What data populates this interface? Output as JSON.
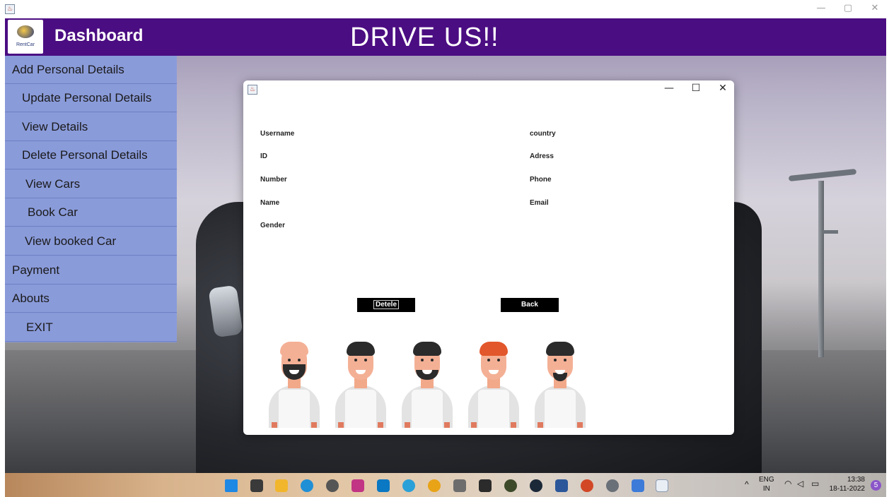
{
  "outer_window": {
    "controls": [
      "—",
      "▢",
      "✕"
    ]
  },
  "header": {
    "logo_text": "RentCar",
    "title": "Dashboard",
    "banner": "DRIVE US!!"
  },
  "sidebar": {
    "items": [
      {
        "label": "Add Personal Details"
      },
      {
        "label": "Update Personal Details"
      },
      {
        "label": "View Details"
      },
      {
        "label": "Delete Personal Details"
      },
      {
        "label": "View Cars"
      },
      {
        "label": "Book Car"
      },
      {
        "label": "View booked Car"
      },
      {
        "label": "Payment"
      },
      {
        "label": "Abouts"
      },
      {
        "label": "EXIT"
      }
    ]
  },
  "dialog": {
    "controls": {
      "minimize": "—",
      "maximize": "☐",
      "close": "✕"
    },
    "left_labels": [
      "Username",
      "ID",
      "Number",
      "Name",
      "Gender"
    ],
    "right_labels": [
      "country",
      "Adress",
      "Phone",
      "Email"
    ],
    "delete_button": "Detele",
    "back_button": "Back",
    "avatar_hair_colors": [
      "#f4b095",
      "#2b2b2b",
      "#2b2b2b",
      "#e2572b",
      "#2b2b2b"
    ]
  },
  "taskbar": {
    "language": "ENG",
    "region": "IN",
    "time": "13:38",
    "date": "18-11-2022",
    "notification_count": "5",
    "apps": [
      "start-icon",
      "task-view-icon",
      "file-explorer-icon",
      "edge-icon",
      "settings-icon",
      "instagram-icon",
      "vscode-icon",
      "telegram-icon",
      "chrome-icon",
      "game-icon",
      "epic-games-icon",
      "game-icon-2",
      "steam-icon",
      "word-icon",
      "powerpoint-icon",
      "settings-gear-icon",
      "app-icon",
      "java-icon"
    ]
  }
}
